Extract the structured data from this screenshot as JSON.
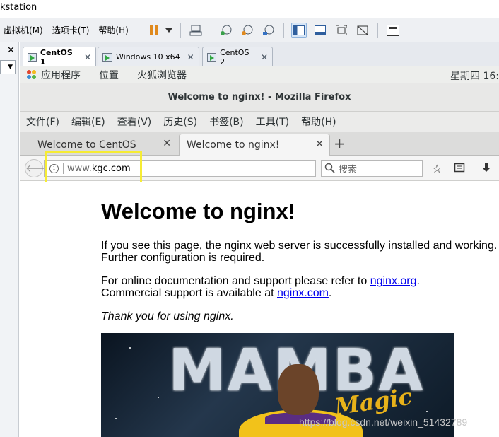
{
  "vmware": {
    "title": "kstation",
    "menus": [
      "虚拟机(M)",
      "选项卡(T)",
      "帮助(H)"
    ],
    "tabs": [
      {
        "label": "CentOS 1",
        "active": true
      },
      {
        "label": "Windows 10 x64",
        "active": false
      },
      {
        "label": "CentOS 2",
        "active": false
      }
    ],
    "toolbar_icons": [
      "pause-icon",
      "dropdown-arrow-icon",
      "send-keys-icon",
      "snapshot-take-icon",
      "snapshot-revert-icon",
      "snapshot-manager-icon",
      "sidebar-view-icon",
      "console-view-icon",
      "fullscreen-icon",
      "unity-icon",
      "thumbnail-view-icon"
    ]
  },
  "gnome": {
    "apps": "应用程序",
    "places": "位置",
    "browser": "火狐浏览器",
    "clock": "星期四 16:"
  },
  "firefox": {
    "window_title": "Welcome to nginx! - Mozilla Firefox",
    "menus": [
      "文件(F)",
      "编辑(E)",
      "查看(V)",
      "历史(S)",
      "书签(B)",
      "工具(T)",
      "帮助(H)"
    ],
    "tabs": [
      {
        "label": "Welcome to CentOS",
        "active": false
      },
      {
        "label": "Welcome to nginx!",
        "active": true
      }
    ],
    "url_prefix": "www.",
    "url_host": "kgc.com",
    "search_placeholder": "搜索"
  },
  "page": {
    "heading": "Welcome to nginx!",
    "p1": "If you see this page, the nginx web server is successfully installed and working. Further configuration is required.",
    "p2_before": "For online documentation and support please refer to ",
    "p2_link": "nginx.org",
    "p2_between": ".",
    "p3_before": "Commercial support is available at ",
    "p3_link": "nginx.com",
    "p3_after": ".",
    "thanks": "Thank you for using nginx.",
    "banner_title": "MAMBA",
    "banner_script": "Magic"
  },
  "watermark": "https://blog.csdn.net/weixin_51432789",
  "colors": {
    "highlight": "#f6ec34",
    "link": "#0000ee"
  }
}
